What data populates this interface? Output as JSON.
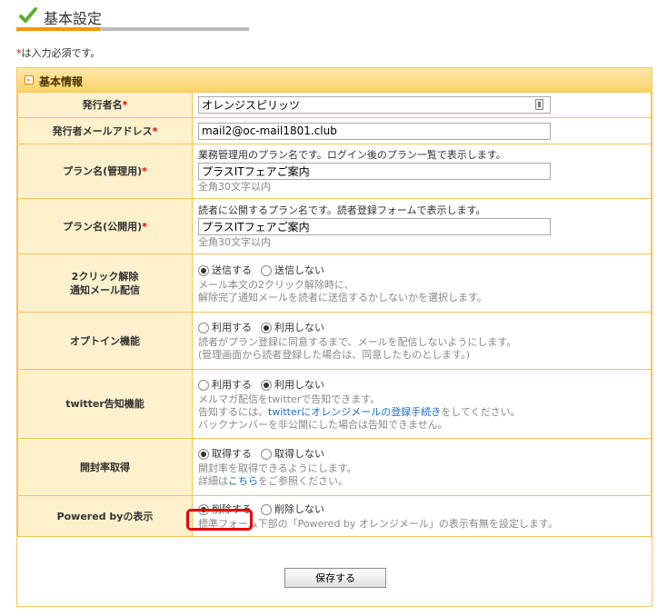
{
  "header": {
    "title": "基本設定",
    "check_icon": "check-icon"
  },
  "required_note": {
    "mark": "*",
    "text": "は入力必須です。"
  },
  "section": {
    "title": "基本情報",
    "icon": "arrow-box-icon"
  },
  "required_mark": "*",
  "fields": {
    "publisher_name": {
      "label": "発行者名",
      "value": "オレンジスピリッツ"
    },
    "publisher_email": {
      "label": "発行者メールアドレス",
      "value": "mail2@oc-mail1801.club"
    },
    "plan_internal": {
      "label": "プラン名(管理用)",
      "desc": "業務管理用のプラン名です。ログイン後のプラン一覧で表示します。",
      "value": "プラスITフェアご案内",
      "note": "全角30文字以内"
    },
    "plan_public": {
      "label": "プラン名(公開用)",
      "desc": "読者に公開するプラン名です。読者登録フォームで表示します。",
      "value": "プラスITフェアご案内",
      "note": "全角30文字以内"
    },
    "two_click": {
      "label_line1": "2クリック解除",
      "label_line2": "通知メール配信",
      "options": [
        "送信する",
        "送信しない"
      ],
      "selected": 0,
      "note_line1": "メール本文の2クリック解除時に、",
      "note_line2": "解除完了通知メールを読者に送信するかしないかを選択します。"
    },
    "opt_in": {
      "label": "オプトイン機能",
      "options": [
        "利用する",
        "利用しない"
      ],
      "selected": 1,
      "note_line1": "読者がプラン登録に同意するまで、メールを配信しないようにします。",
      "note_line2": "(管理画面から読者登録した場合は、同意したものとします。)"
    },
    "twitter": {
      "label": "twitter告知機能",
      "options": [
        "利用する",
        "利用しない"
      ],
      "selected": 1,
      "note_line1": "メルマガ配信をtwitterで告知できます。",
      "note_line2_pre": "告知するには、",
      "note_line2_link": "twitterにオレンジメールの登録手続き",
      "note_line2_post": "をしてください。",
      "note_line3": "バックナンバーを非公開にした場合は告知できません。"
    },
    "open_rate": {
      "label": "開封率取得",
      "options": [
        "取得する",
        "取得しない"
      ],
      "selected": 0,
      "note_line1": "開封率を取得できるようにします。",
      "note_line2_pre": "詳細は",
      "note_line2_link": "こちら",
      "note_line2_post": "をご参照ください。"
    },
    "powered_by": {
      "label": "Powered byの表示",
      "options": [
        "削除する",
        "削除しない"
      ],
      "selected": 0,
      "note": "標準フォーム下部の「Powered by オレンジメール」の表示有無を設定します。"
    }
  },
  "save_button": "保存する",
  "colors": {
    "accent": "#f39800",
    "header_bg": "#fbd36a",
    "label_bg": "#fdf0cc",
    "border": "#f5c35a",
    "required": "#e60000",
    "highlight": "#e60000"
  }
}
